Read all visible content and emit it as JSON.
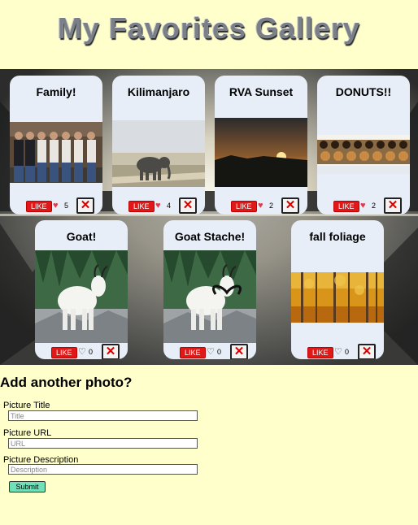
{
  "page": {
    "title": "My Favorites Gallery"
  },
  "gallery": {
    "cards": [
      {
        "title": "Family!",
        "like_label": "LIKE",
        "likes": "5",
        "liked": true,
        "delete_label": "✕",
        "photo": "family-photo"
      },
      {
        "title": "Kilimanjaro",
        "like_label": "LIKE",
        "likes": "4",
        "liked": true,
        "delete_label": "✕",
        "photo": "elephant-photo"
      },
      {
        "title": "RVA Sunset",
        "like_label": "LIKE",
        "likes": "2",
        "liked": true,
        "delete_label": "✕",
        "photo": "sunset-photo"
      },
      {
        "title": "DONUTS!!",
        "like_label": "LIKE",
        "likes": "2",
        "liked": true,
        "delete_label": "✕",
        "photo": "donuts-photo"
      },
      {
        "title": "Goat!",
        "like_label": "LIKE",
        "likes": "0",
        "liked": false,
        "delete_label": "✕",
        "photo": "goat-photo"
      },
      {
        "title": "Goat Stache!",
        "like_label": "LIKE",
        "likes": "0",
        "liked": false,
        "delete_label": "✕",
        "photo": "goat-mustache-photo"
      },
      {
        "title": "fall foliage",
        "like_label": "LIKE",
        "likes": "0",
        "liked": false,
        "delete_label": "✕",
        "photo": "autumn-forest-photo"
      }
    ]
  },
  "form": {
    "heading": "Add another photo?",
    "title_label": "Picture Title",
    "title_placeholder": "Title",
    "url_label": "Picture URL",
    "url_placeholder": "URL",
    "description_label": "Picture Description",
    "description_placeholder": "Description",
    "submit_label": "Submit"
  },
  "colors": {
    "background": "#ffffcc",
    "card": "#e7eef7",
    "like_button": "#e01818",
    "delete_x": "#d40000",
    "submit_button": "#6fe0b7"
  },
  "icons": {
    "liked": "heart-filled-icon",
    "unliked": "heart-outline-icon",
    "delete": "close-icon"
  }
}
